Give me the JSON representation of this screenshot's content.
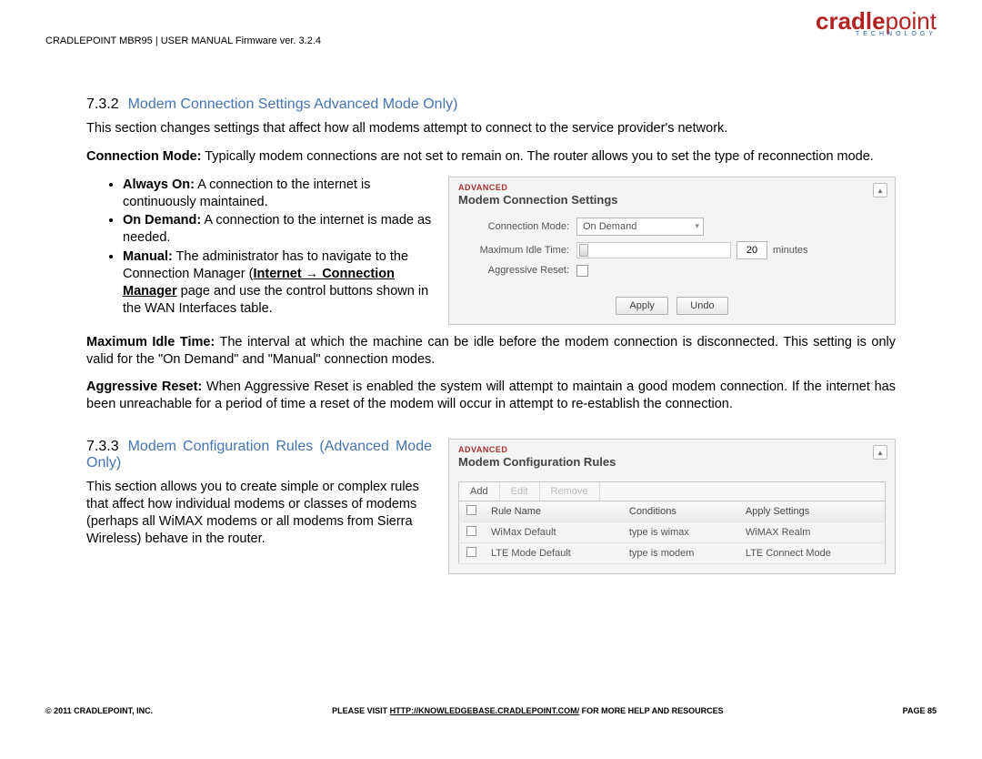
{
  "header": {
    "logo_main": "cradlepoint",
    "logo_sub": "TECHNOLOGY",
    "doc_title": "CRADLEPOINT MBR95 | USER MANUAL Firmware ver. 3.2.4"
  },
  "section1": {
    "num": "7.3.2",
    "title": "Modem Connection Settings Advanced Mode Only)",
    "intro": "This section changes settings that affect how all modems attempt to connect to the service provider's network.",
    "conn_mode_label": "Connection Mode:",
    "conn_mode_text": " Typically modem connections are not set to remain on. The router allows you to set the type of reconnection mode.",
    "bullets": {
      "always_label": "Always On:",
      "always_text": " A connection to the internet is continuously maintained.",
      "ondemand_label": "On Demand:",
      "ondemand_text": " A connection to the internet is made as needed.",
      "manual_label": "Manual:",
      "manual_text_a": " The administrator has to navigate to the Connection Manager (",
      "manual_link": "Internet → Connection Manager",
      "manual_text_b": " page and use the control buttons shown in the WAN Interfaces table."
    },
    "max_idle_label": "Maximum Idle Time:",
    "max_idle_text": " The interval at which the machine can be idle before the modem connection is disconnected. This setting is only valid for the \"On Demand\" and \"Manual\" connection modes.",
    "agg_reset_label": "Aggressive Reset:",
    "agg_reset_text": " When Aggressive Reset is enabled the system will attempt to maintain a good modem connection. If the internet has been unreachable for a period of time a reset of the modem will occur in attempt to re-establish the connection."
  },
  "panel1": {
    "badge": "ADVANCED",
    "title": "Modem Connection Settings",
    "collapse": "▴",
    "rows": {
      "conn_mode": {
        "label": "Connection Mode:",
        "value": "On Demand"
      },
      "idle": {
        "label": "Maximum Idle Time:",
        "value": "20",
        "unit": "minutes"
      },
      "agg": {
        "label": "Aggressive Reset:"
      }
    },
    "apply": "Apply",
    "undo": "Undo"
  },
  "section2": {
    "num": "7.3.3",
    "title": "Modem Configuration Rules (Advanced Mode Only)",
    "text": "This section allows you to create simple or complex rules that affect how individual modems or classes of modems (perhaps all WiMAX modems or all modems from Sierra Wireless) behave in the router."
  },
  "panel2": {
    "badge": "ADVANCED",
    "title": "Modem Configuration Rules",
    "collapse": "▴",
    "toolbar": {
      "add": "Add",
      "edit": "Edit",
      "remove": "Remove"
    },
    "columns": {
      "name": "Rule Name",
      "cond": "Conditions",
      "apply": "Apply Settings"
    },
    "rows": [
      {
        "name": "WiMax Default",
        "cond": "type is wimax",
        "apply": "WiMAX Realm"
      },
      {
        "name": "LTE Mode Default",
        "cond": "type is modem",
        "apply": "LTE Connect Mode"
      }
    ]
  },
  "footer": {
    "left": "© 2011 CRADLEPOINT, INC.",
    "mid_a": "PLEASE VISIT ",
    "mid_link": "HTTP://KNOWLEDGEBASE.CRADLEPOINT.COM/",
    "mid_b": " FOR MORE HELP AND RESOURCES",
    "right": "PAGE 85"
  }
}
